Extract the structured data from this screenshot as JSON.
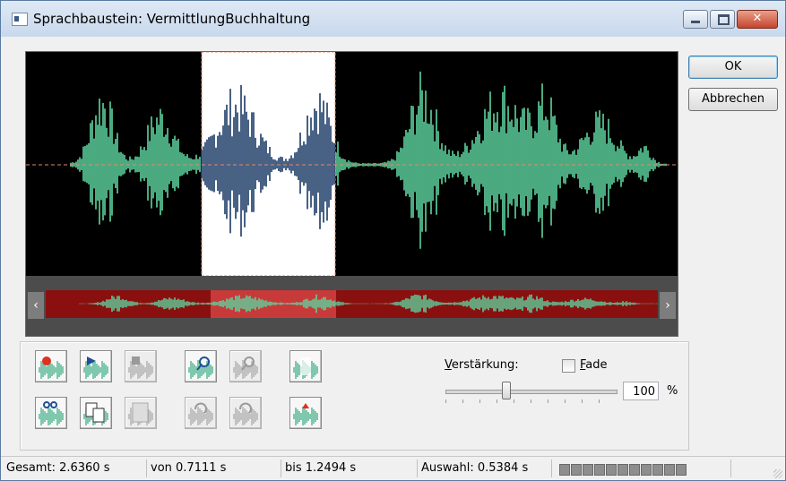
{
  "window": {
    "title": "Sprachbaustein: VermittlungBuchhaltung",
    "controls": {
      "minimize": "minimize-icon",
      "maximize": "maximize-icon",
      "close": "✕"
    }
  },
  "buttons": {
    "ok": "OK",
    "cancel": "Abbrechen"
  },
  "waveform": {
    "wave_color": "#5ed4a0",
    "selection_wave_color": "#1a3a66",
    "selection_bg": "#ffffff",
    "center_line_color": "#e08a6a",
    "overview_bg": "#8a1010",
    "selection_start_s": 0.7111,
    "selection_end_s": 1.2494,
    "total_s": 2.636
  },
  "tools": [
    {
      "name": "record-button",
      "icon": "record-icon",
      "enabled": true
    },
    {
      "name": "play-button",
      "icon": "play-icon",
      "enabled": true
    },
    {
      "name": "stop-button",
      "icon": "stop-icon",
      "enabled": false
    },
    {
      "name": "zoom-in-button",
      "icon": "zoom-in-icon",
      "enabled": true
    },
    {
      "name": "zoom-out-button",
      "icon": "zoom-out-icon",
      "enabled": false
    },
    {
      "name": "select-all-button",
      "icon": "select-all-icon",
      "enabled": true
    },
    {
      "name": "cut-button",
      "icon": "cut-icon",
      "enabled": true
    },
    {
      "name": "copy-button",
      "icon": "copy-icon",
      "enabled": true
    },
    {
      "name": "paste-button",
      "icon": "paste-icon",
      "enabled": false
    },
    {
      "name": "undo-button",
      "icon": "undo-icon",
      "enabled": false
    },
    {
      "name": "redo-button",
      "icon": "redo-icon",
      "enabled": false
    },
    {
      "name": "normalize-button",
      "icon": "normalize-icon",
      "enabled": true
    }
  ],
  "gain": {
    "label_underlined": "V",
    "label_rest": "erstärkung:",
    "value": "100",
    "unit": "%",
    "slider_level_percent": 100
  },
  "fade": {
    "label_underlined": "F",
    "label_rest": "ade",
    "checked": false
  },
  "status": {
    "total": "Gesamt: 2.6360 s",
    "from": "von 0.7111 s",
    "to": "bis 1.2494 s",
    "selection": "Auswahl: 0.5384 s",
    "progress_segments": 11
  }
}
